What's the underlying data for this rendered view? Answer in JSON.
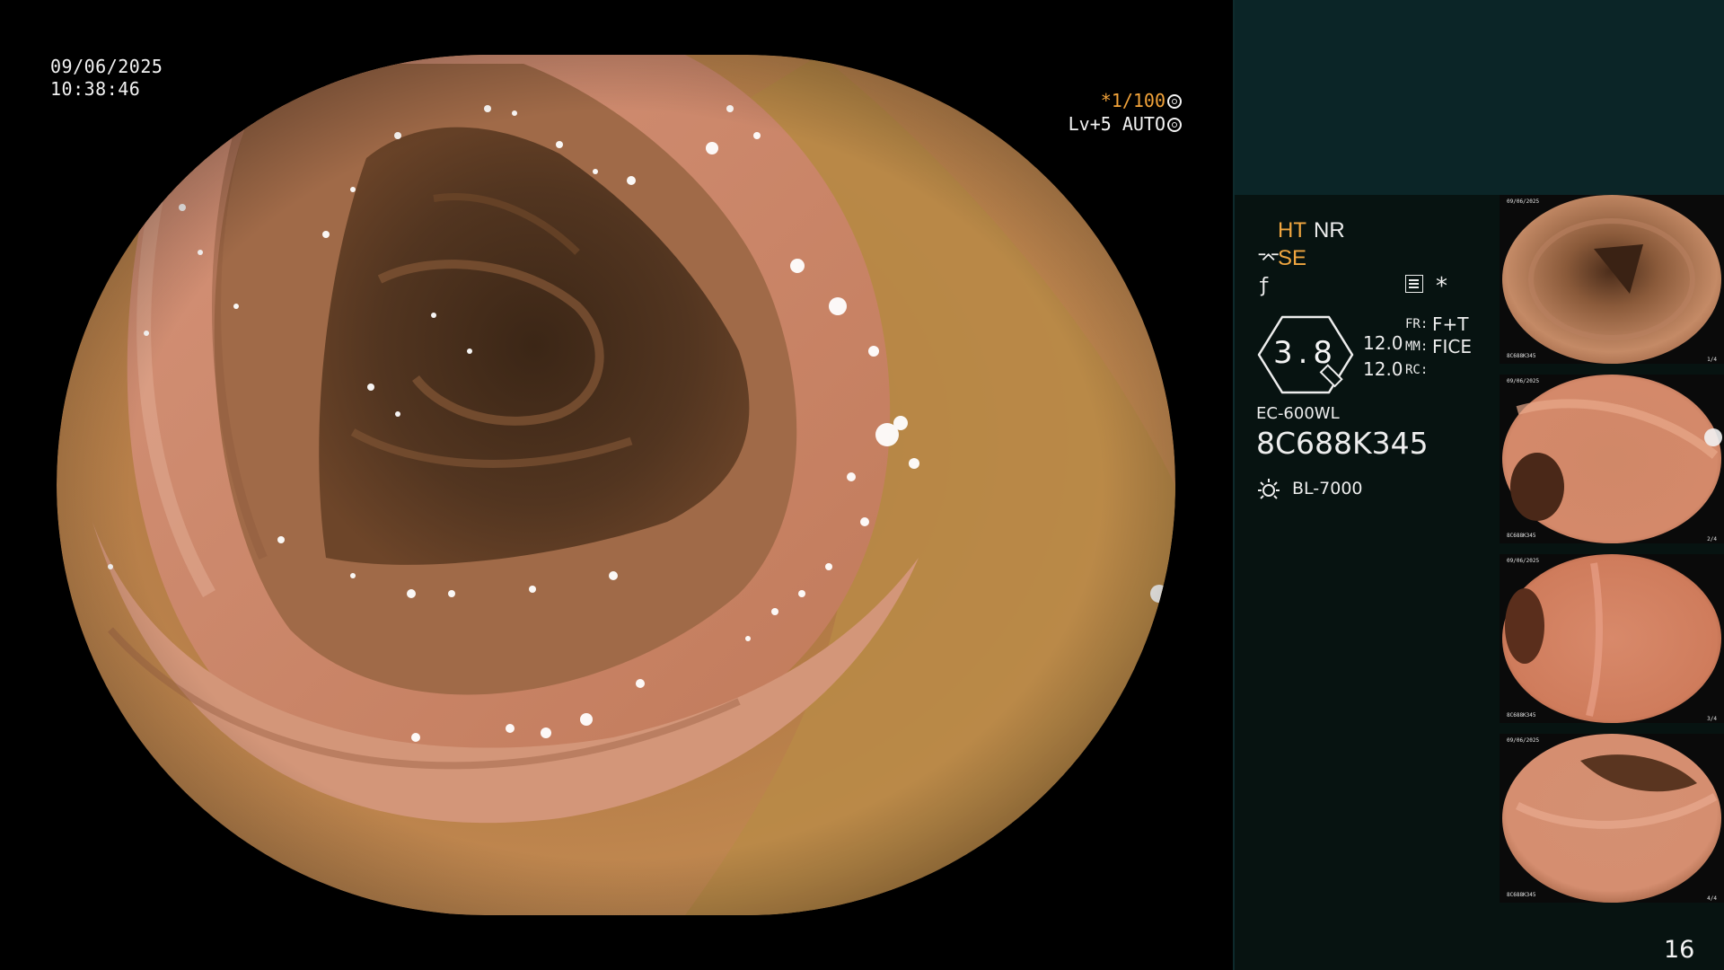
{
  "capture": {
    "date": "09/06/2025",
    "time": "10:38:46"
  },
  "shutter": {
    "speed": "*1/100",
    "level": "Lv+5",
    "mode": "AUTO"
  },
  "panel": {
    "ht": "HT",
    "nr": "NR",
    "se": "SE",
    "zoom": "3.8",
    "value_1": "12.0",
    "value_2": "12.0",
    "fr_label": "FR:",
    "fr_value": "F+T",
    "mm_label": "MM:",
    "mm_value": "FICE",
    "rc_label": "RC:",
    "scope_model": "EC-600WL",
    "scope_serial": "8C688K345",
    "light_source": "BL-7000"
  },
  "thumbnails": [
    {
      "serial": "8C688K345",
      "date": "09/06/2025",
      "page": "1/4"
    },
    {
      "serial": "8C688K345",
      "date": "09/06/2025",
      "page": "2/4"
    },
    {
      "serial": "8C688K345",
      "date": "09/06/2025",
      "page": "3/4"
    },
    {
      "serial": "8C688K345",
      "date": "09/06/2025",
      "page": "4/4"
    }
  ],
  "page_number": "16",
  "colors": {
    "osd_amber": "#f0a640",
    "panel_background": "#071311",
    "panel_top_band": "#0b2527"
  },
  "icons": [
    "shutter-icon",
    "auto-icon",
    "structure-enhance-icon",
    "f-icon",
    "menu-icon",
    "star-icon",
    "magnifier-icon",
    "light-source-icon"
  ]
}
